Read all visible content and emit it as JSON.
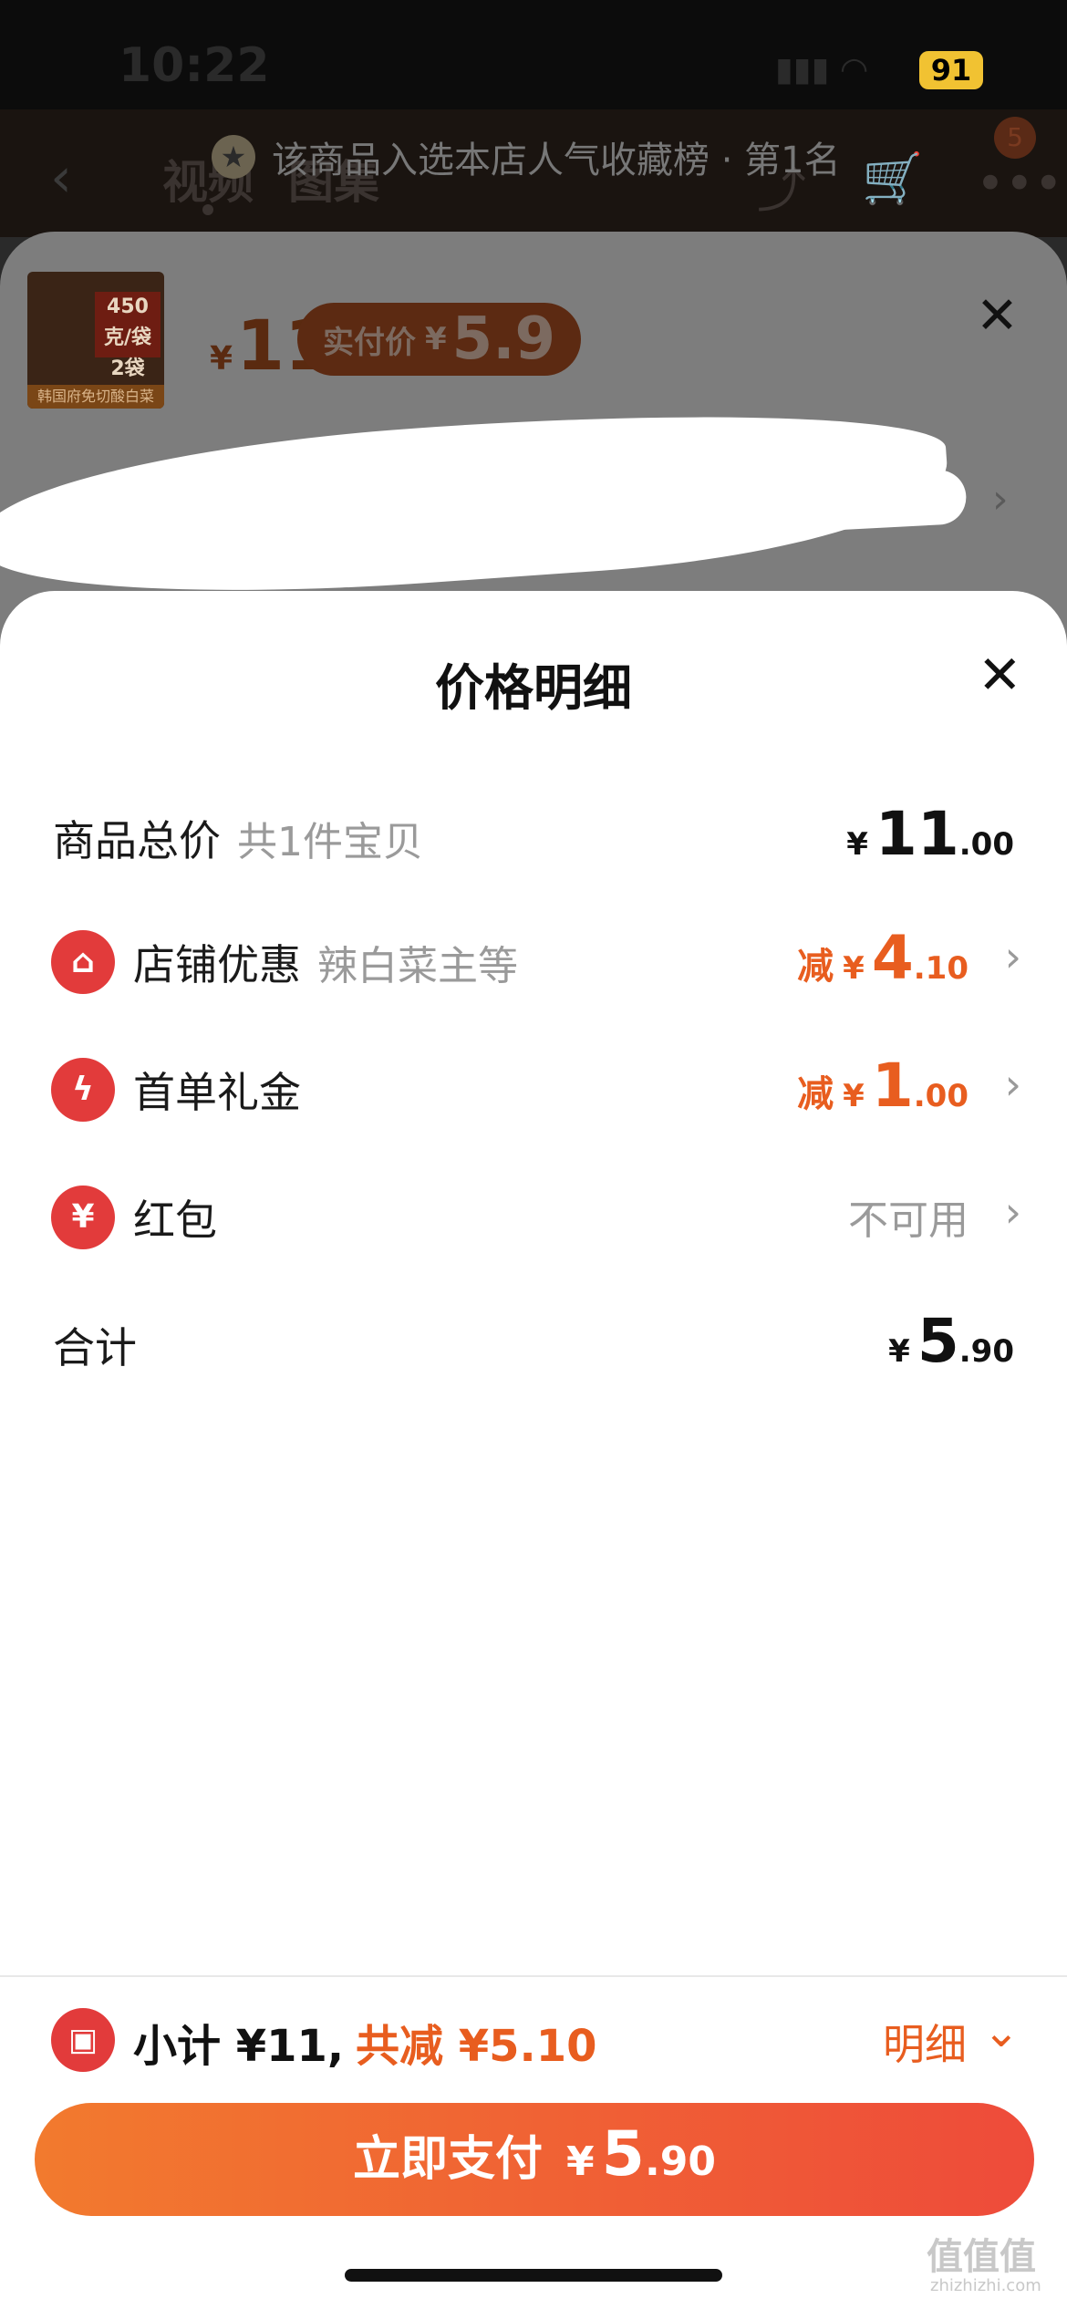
{
  "status": {
    "time": "10:22",
    "battery": "91"
  },
  "nav": {
    "back": "‹",
    "tab_video": "视频",
    "tab_image": "图集",
    "cart_badge": "5"
  },
  "rank_banner": {
    "text": "该商品入选本店人气收藏榜 · 第1名"
  },
  "sku": {
    "thumb_tag": "450克/袋 2袋",
    "thumb_bottom": "韩国府免切酸白菜",
    "price_yen": "¥",
    "price": "11",
    "pay_label": "实付价",
    "pay_yen": "¥",
    "pay_price": "5.9"
  },
  "detail": {
    "title": "价格明细",
    "rows": [
      {
        "label": "商品总价",
        "sub": "共1件宝贝",
        "prefix": "",
        "yen": "¥",
        "int": "11",
        "dec": ".00"
      },
      {
        "label": "店铺优惠",
        "sub": "辣白菜主等",
        "prefix": "减",
        "yen": "¥",
        "int": "4",
        "dec": ".10"
      },
      {
        "label": "首单礼金",
        "sub": "",
        "prefix": "减",
        "yen": "¥",
        "int": "1",
        "dec": ".00"
      },
      {
        "label": "红包",
        "sub": "",
        "status": "不可用"
      },
      {
        "label": "合计",
        "sub": "",
        "prefix": "",
        "yen": "¥",
        "int": "5",
        "dec": ".90"
      }
    ]
  },
  "summary": {
    "subtotal": "小计 ¥11,",
    "saving": "共减 ¥5.10",
    "detail_label": "明细"
  },
  "pay_button": {
    "label": "立即支付",
    "yen": "¥",
    "int": "5",
    "dec": ".90"
  },
  "watermark": {
    "main": "值值值",
    "sub": "zhizhizhi.com"
  },
  "colors": {
    "accent_orange": "#e85d1f",
    "icon_red": "#e23b3b",
    "battery_yellow": "#f1c232"
  },
  "icons": {
    "store": "store-icon",
    "lightning": "lightning-icon",
    "red_packet": "red-packet-icon",
    "ticket": "ticket-icon"
  }
}
